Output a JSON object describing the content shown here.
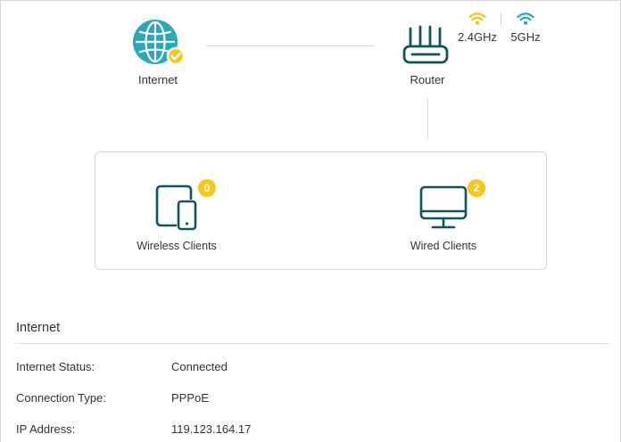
{
  "topology": {
    "internet": {
      "label": "Internet",
      "status_icon": "check-badge-icon"
    },
    "router": {
      "label": "Router"
    },
    "bands": [
      {
        "label": "2.4GHz",
        "icon": "wifi-icon",
        "color": "#f0c419"
      },
      {
        "label": "5GHz",
        "icon": "wifi-icon",
        "color": "#2ba8b8"
      }
    ],
    "wireless_clients": {
      "label": "Wireless Clients",
      "count": "0"
    },
    "wired_clients": {
      "label": "Wired Clients",
      "count": "2"
    }
  },
  "internet_section": {
    "title": "Internet",
    "rows": [
      {
        "label": "Internet Status:",
        "value": "Connected"
      },
      {
        "label": "Connection Type:",
        "value": "PPPoE"
      },
      {
        "label": "IP Address:",
        "value": "119.123.164.17"
      }
    ]
  },
  "colors": {
    "teal": "#2ba8b8",
    "dark_teal": "#11555c",
    "badge_yellow": "#f6c619",
    "line_gray": "#d9d9d9"
  }
}
